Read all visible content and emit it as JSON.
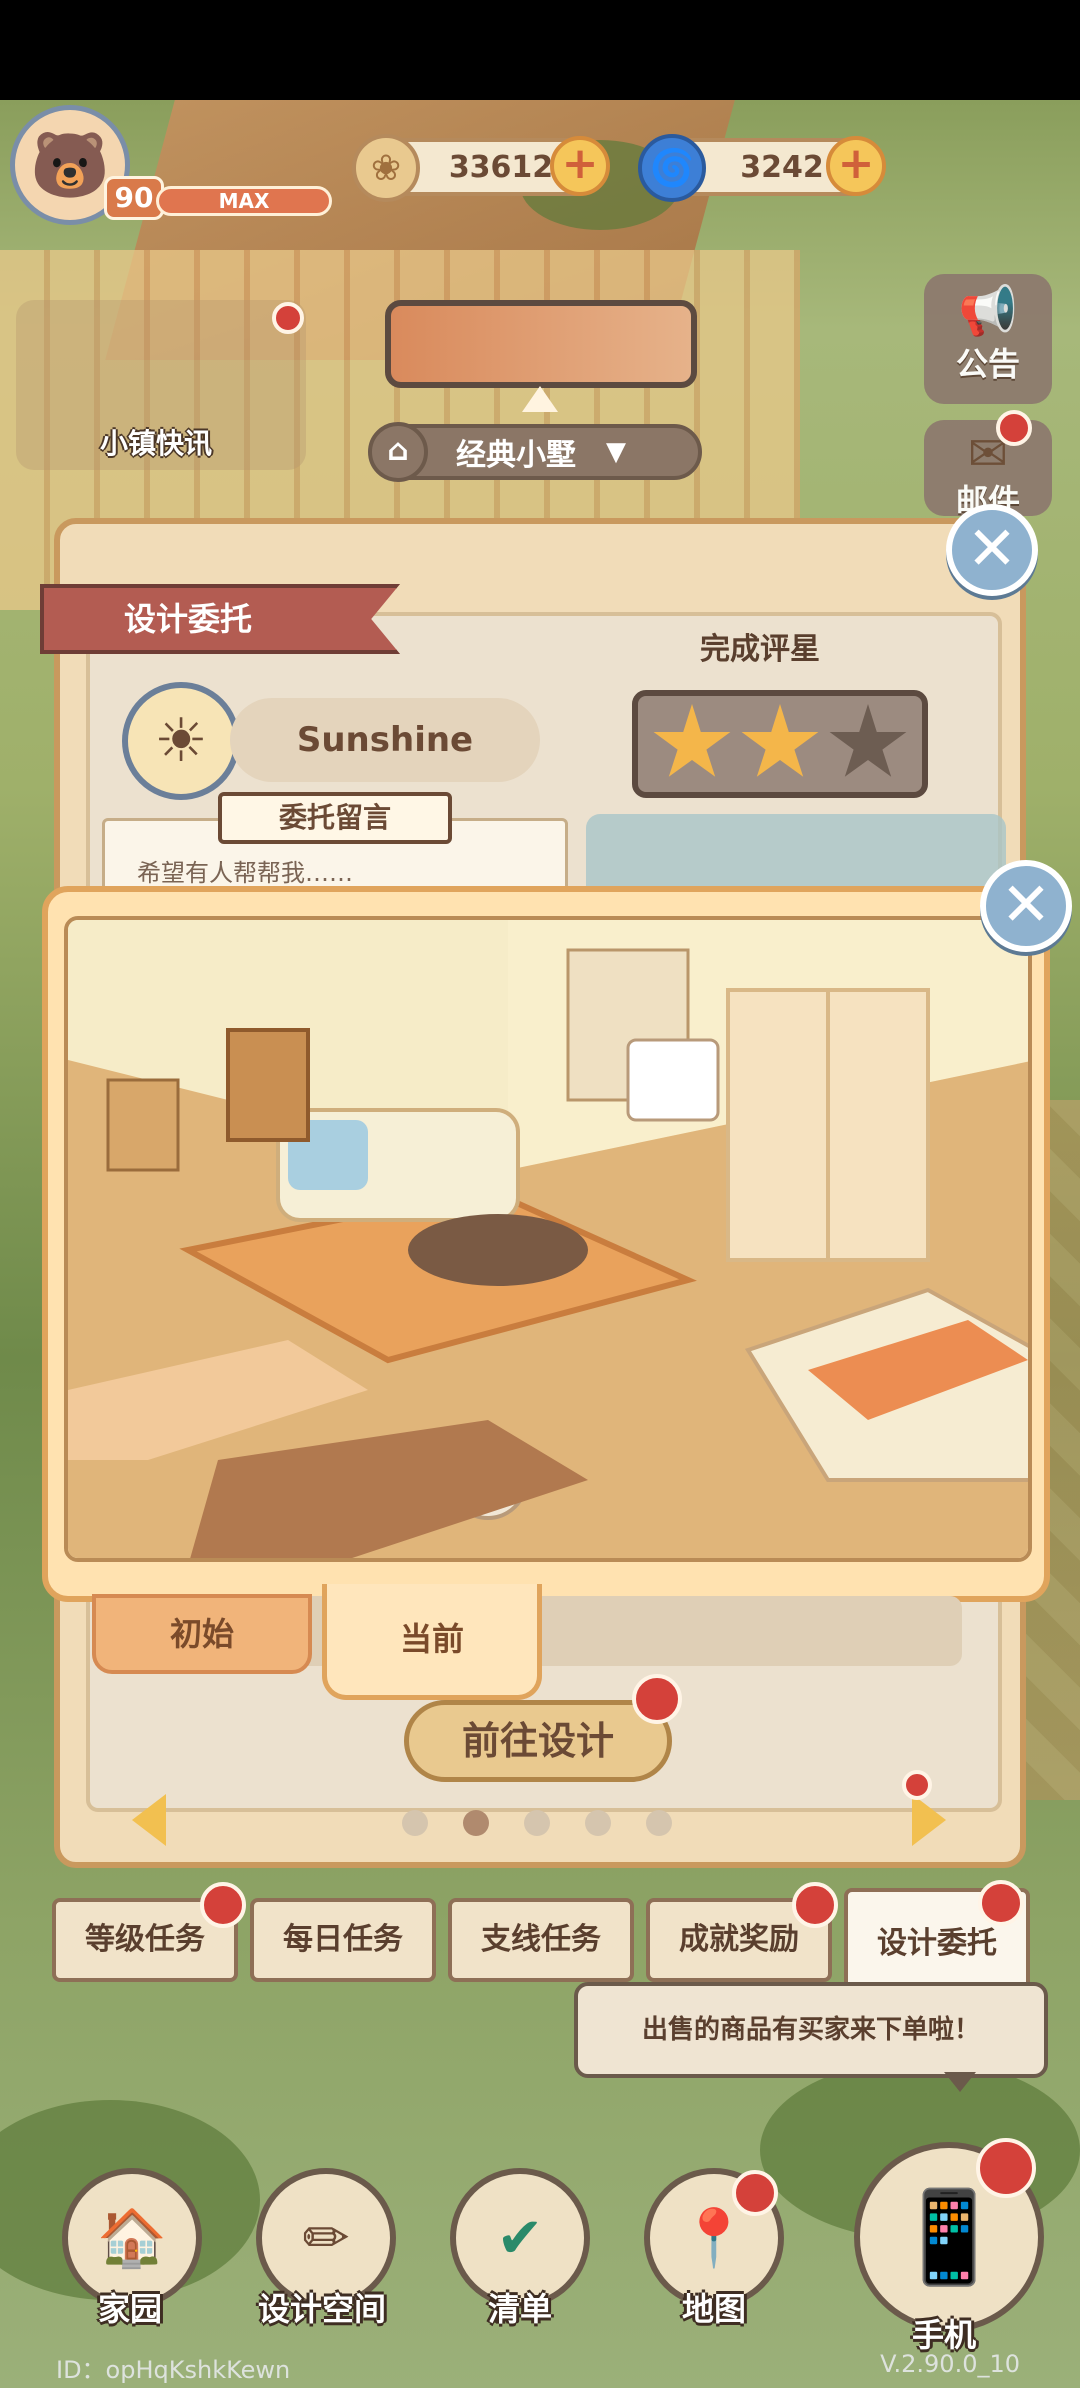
{
  "player": {
    "avatar_icon": "bear-face-icon",
    "level": "90",
    "level_bar_label": "MAX"
  },
  "currencies": [
    {
      "icon": "coin-icon",
      "value": "33612",
      "plus": "+"
    },
    {
      "icon": "swirl-gem-icon",
      "value": "3242",
      "plus": "+"
    }
  ],
  "side": {
    "notice_label": "公告",
    "mail_label": "邮件"
  },
  "town_news_label": "小镇快讯",
  "house_select": {
    "label": "经典小墅",
    "arrow": "▼"
  },
  "dialog": {
    "title": "设计委托",
    "close": "✕",
    "client_name": "Sunshine",
    "rating_label": "完成评星",
    "stars_filled": 2,
    "stars_total": 3,
    "message_label": "委托留言",
    "message_text": "希望有人帮帮我……",
    "go_design": "前往设计",
    "pages_total": 5,
    "page_current": 2
  },
  "popup": {
    "close": "✕",
    "tabs": [
      "初始",
      "当前"
    ],
    "active_tab": "当前"
  },
  "task_tabs": [
    "等级任务",
    "每日任务",
    "支线任务",
    "成就奖励",
    "设计委托"
  ],
  "tooltip": "出售的商品有买家来下单啦！",
  "bottom_nav": [
    {
      "label": "家园",
      "icon": "home-icon"
    },
    {
      "label": "设计空间",
      "icon": "design-space-icon"
    },
    {
      "label": "清单",
      "icon": "checklist-icon"
    },
    {
      "label": "地图",
      "icon": "map-pin-icon"
    },
    {
      "label": "手机",
      "icon": "phone-icon"
    }
  ],
  "footer": {
    "id": "ID：opHqKshkKewn",
    "version": "V.2.90.0_10"
  },
  "colors": {
    "accent": "#e0a45c",
    "ribbon": "#b35c52",
    "badge_red": "#d4413a",
    "star": "#f4b64a"
  }
}
